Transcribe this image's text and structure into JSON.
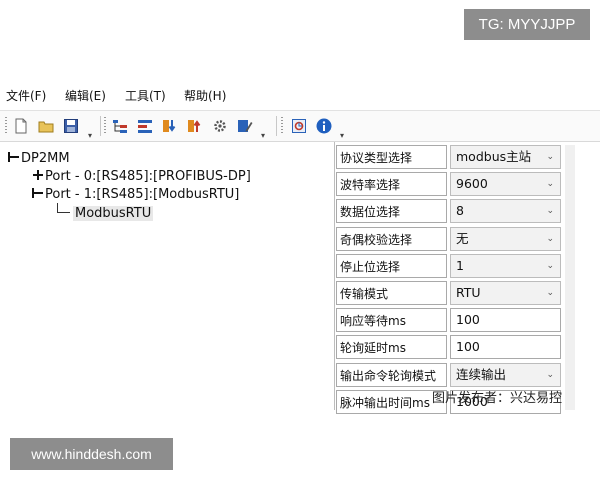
{
  "watermarks": {
    "top": "TG: MYYJJPP",
    "bottom": "www.hinddesh.com"
  },
  "menu": [
    {
      "label": "文件(F)"
    },
    {
      "label": "编辑(E)"
    },
    {
      "label": "工具(T)"
    },
    {
      "label": "帮助(H)"
    }
  ],
  "toolbar": {
    "icons": [
      "new-file-icon",
      "open-folder-icon",
      "save-icon",
      "config-tree-icon",
      "config-list-icon",
      "download-icon",
      "upload-icon",
      "settings-icon",
      "edit-icon",
      "monitor-icon",
      "info-icon"
    ]
  },
  "tree": {
    "root": "DP2MM",
    "port0": "Port - 0:[RS485]:[PROFIBUS-DP]",
    "port1": "Port - 1:[RS485]:[ModbusRTU]",
    "leaf": "ModbusRTU"
  },
  "properties": [
    {
      "label": "协议类型选择",
      "value": "modbus主站",
      "type": "combo"
    },
    {
      "label": "波特率选择",
      "value": "9600",
      "type": "combo"
    },
    {
      "label": "数据位选择",
      "value": "8",
      "type": "combo"
    },
    {
      "label": "奇偶校验选择",
      "value": "无",
      "type": "combo"
    },
    {
      "label": "停止位选择",
      "value": "1",
      "type": "combo"
    },
    {
      "label": "传输模式",
      "value": "RTU",
      "type": "combo"
    },
    {
      "label": "响应等待ms",
      "value": "100",
      "type": "text"
    },
    {
      "label": "轮询延时ms",
      "value": "100",
      "type": "text"
    },
    {
      "label": "输出命令轮询模式",
      "value": "连续输出",
      "type": "combo"
    },
    {
      "label": "脉冲输出时间ms",
      "value": "1000",
      "type": "text"
    }
  ],
  "credit": "图片发布者：兴达易控",
  "colors": {
    "icon_blue": "#2a62b8",
    "icon_red": "#c0392b",
    "icon_orange": "#e08a1e",
    "watermark_bg": "#8d8d8d"
  }
}
